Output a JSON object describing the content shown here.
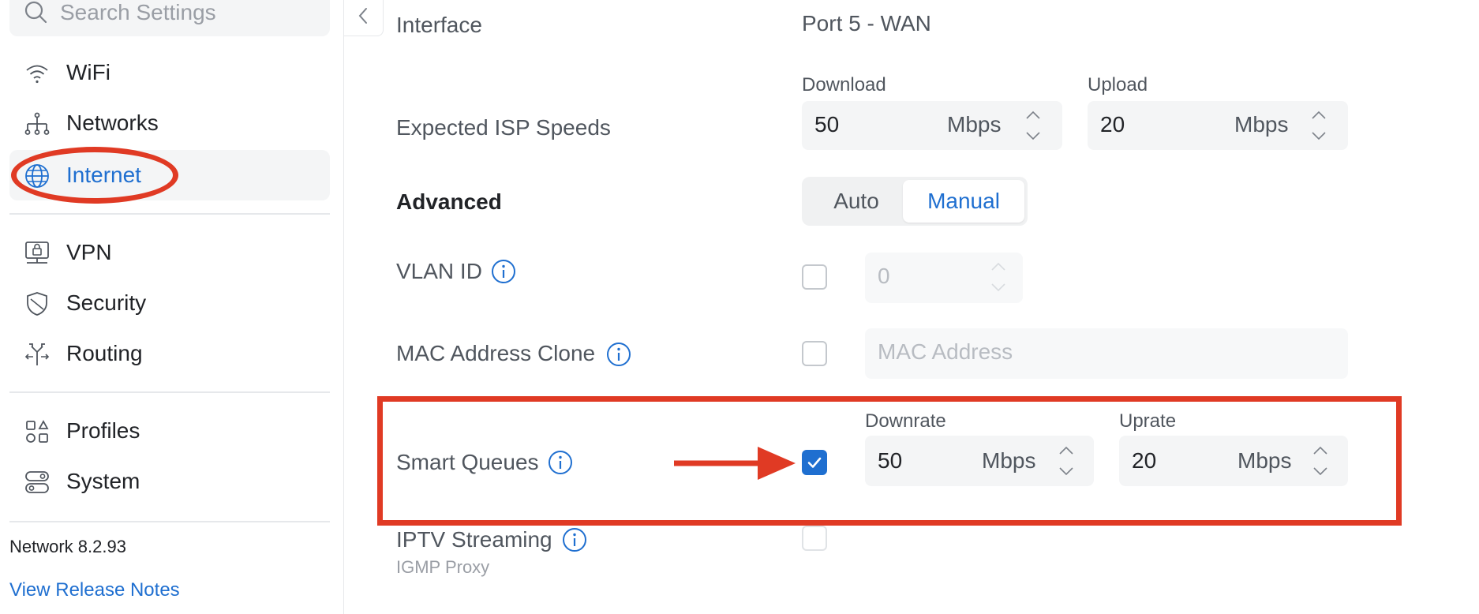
{
  "sidebar": {
    "search_placeholder": "Search Settings",
    "items": [
      {
        "label": "WiFi",
        "icon": "wifi-icon"
      },
      {
        "label": "Networks",
        "icon": "network-topology-icon"
      },
      {
        "label": "Internet",
        "icon": "globe-icon",
        "active": true
      },
      {
        "label": "VPN",
        "icon": "vpn-lock-icon"
      },
      {
        "label": "Security",
        "icon": "shield-icon"
      },
      {
        "label": "Routing",
        "icon": "routing-arrows-icon"
      },
      {
        "label": "Profiles",
        "icon": "profiles-grid-icon"
      },
      {
        "label": "System",
        "icon": "system-toggles-icon"
      }
    ],
    "version": "Network 8.2.93",
    "release_notes": "View Release Notes"
  },
  "main": {
    "interface": {
      "label": "Interface",
      "value": "Port 5 - WAN"
    },
    "isp_speeds": {
      "label": "Expected ISP Speeds",
      "download": {
        "label": "Download",
        "value": "50",
        "unit": "Mbps"
      },
      "upload": {
        "label": "Upload",
        "value": "20",
        "unit": "Mbps"
      }
    },
    "advanced": {
      "label": "Advanced",
      "options": [
        "Auto",
        "Manual"
      ],
      "selected": "Manual"
    },
    "vlan": {
      "label": "VLAN ID",
      "value": "0",
      "checked": false
    },
    "mac_clone": {
      "label": "MAC Address Clone",
      "placeholder": "MAC Address",
      "checked": false
    },
    "smart_queues": {
      "label": "Smart Queues",
      "checked": true,
      "downrate": {
        "label": "Downrate",
        "value": "50",
        "unit": "Mbps"
      },
      "uprate": {
        "label": "Uprate",
        "value": "20",
        "unit": "Mbps"
      }
    },
    "iptv": {
      "label": "IPTV Streaming",
      "sublabel": "IGMP Proxy",
      "checked": false
    }
  },
  "colors": {
    "accent": "#1f6fd0",
    "annotation": "#e03a24",
    "field_bg": "#f4f5f6"
  }
}
